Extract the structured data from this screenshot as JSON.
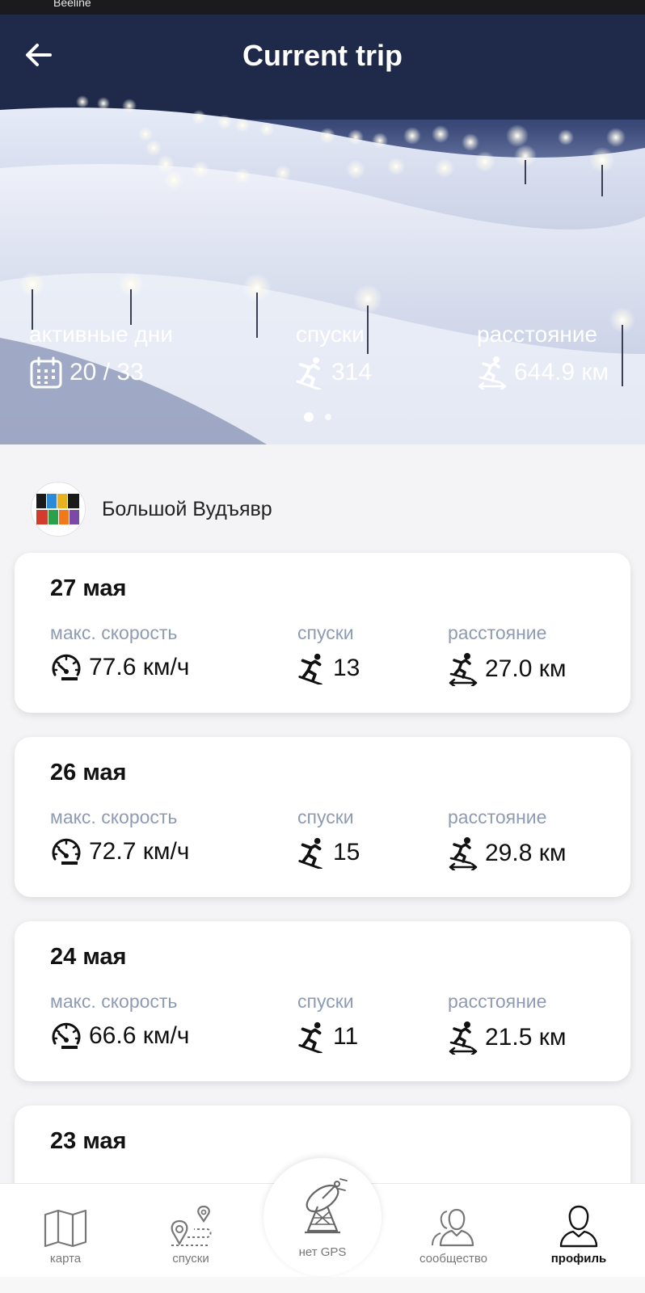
{
  "status_bar": {
    "carrier": "Beeline"
  },
  "header": {
    "title": "Current trip"
  },
  "summary": {
    "active_days": {
      "label": "активные дни",
      "value": "20 / 33"
    },
    "runs": {
      "label": "спуски",
      "value": "314"
    },
    "distance": {
      "label": "расстояние",
      "value": "644.9 км"
    }
  },
  "carousel": {
    "pages": 2,
    "active_page": 1
  },
  "resort": {
    "name": "Большой Вудъявр"
  },
  "days": [
    {
      "date": "27 мая",
      "max_speed_label": "макс. скорость",
      "max_speed": "77.6 км/ч",
      "runs_label": "спуски",
      "runs": "13",
      "distance_label": "расстояние",
      "distance": "27.0 км"
    },
    {
      "date": "26 мая",
      "max_speed_label": "макс. скорость",
      "max_speed": "72.7 км/ч",
      "runs_label": "спуски",
      "runs": "15",
      "distance_label": "расстояние",
      "distance": "29.8 км"
    },
    {
      "date": "24 мая",
      "max_speed_label": "макс. скорость",
      "max_speed": "66.6 км/ч",
      "runs_label": "спуски",
      "runs": "11",
      "distance_label": "расстояние",
      "distance": "21.5 км"
    },
    {
      "date": "23 мая"
    }
  ],
  "bottom_nav": {
    "map": "карта",
    "runs": "спуски",
    "gps": "нет GPS",
    "community": "сообщество",
    "profile": "профиль"
  },
  "icons": {
    "back": "arrow-left-icon",
    "calendar": "calendar-icon",
    "skier": "skier-icon",
    "distance": "distance-skier-icon",
    "speedometer": "speedometer-icon",
    "map": "map-icon",
    "route": "route-pin-icon",
    "satellite": "satellite-dish-icon",
    "community": "community-icon",
    "profile": "profile-icon"
  },
  "colors": {
    "label_gray": "#8e9bb3",
    "card_bg": "#ffffff",
    "page_bg": "#f4f4f6",
    "hero_text": "#ffffff"
  }
}
